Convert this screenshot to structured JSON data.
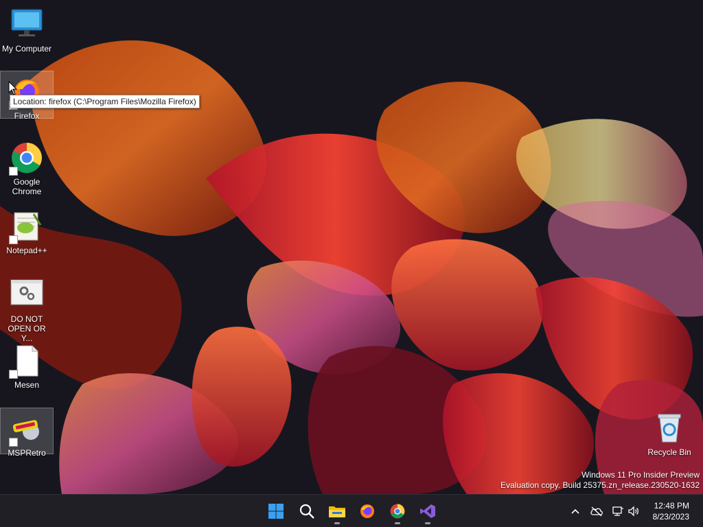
{
  "desktop": {
    "icons": [
      {
        "label": "My Computer"
      },
      {
        "label": "Firefox"
      },
      {
        "label": "Google Chrome"
      },
      {
        "label": "Notepad++"
      },
      {
        "label": "DO NOT OPEN OR Y..."
      },
      {
        "label": "Mesen"
      },
      {
        "label": "MSPRetro"
      },
      {
        "label": "Recycle Bin"
      }
    ],
    "tooltip": "Location: firefox (C:\\Program Files\\Mozilla Firefox)",
    "watermark": {
      "line1": "Windows 11 Pro Insider Preview",
      "line2": "Evaluation copy. Build 25375.zn_release.230520-1632"
    }
  },
  "taskbar": {
    "apps": [
      {
        "icon": "windows-start-icon"
      },
      {
        "icon": "search-icon"
      },
      {
        "icon": "file-explorer-icon"
      },
      {
        "icon": "firefox-icon"
      },
      {
        "icon": "chrome-icon"
      },
      {
        "icon": "visual-studio-icon"
      }
    ],
    "tray": [
      {
        "icon": "chevron-up-icon"
      },
      {
        "icon": "cloud-offline-icon"
      },
      {
        "icon": "network-icon"
      },
      {
        "icon": "speaker-icon"
      }
    ],
    "clock": {
      "time": "12:48 PM",
      "date": "8/23/2023"
    }
  },
  "colors": {
    "taskbar_bg": "#1f1f25",
    "desktop_bg": "#17161f",
    "accent": "#0078d4"
  }
}
